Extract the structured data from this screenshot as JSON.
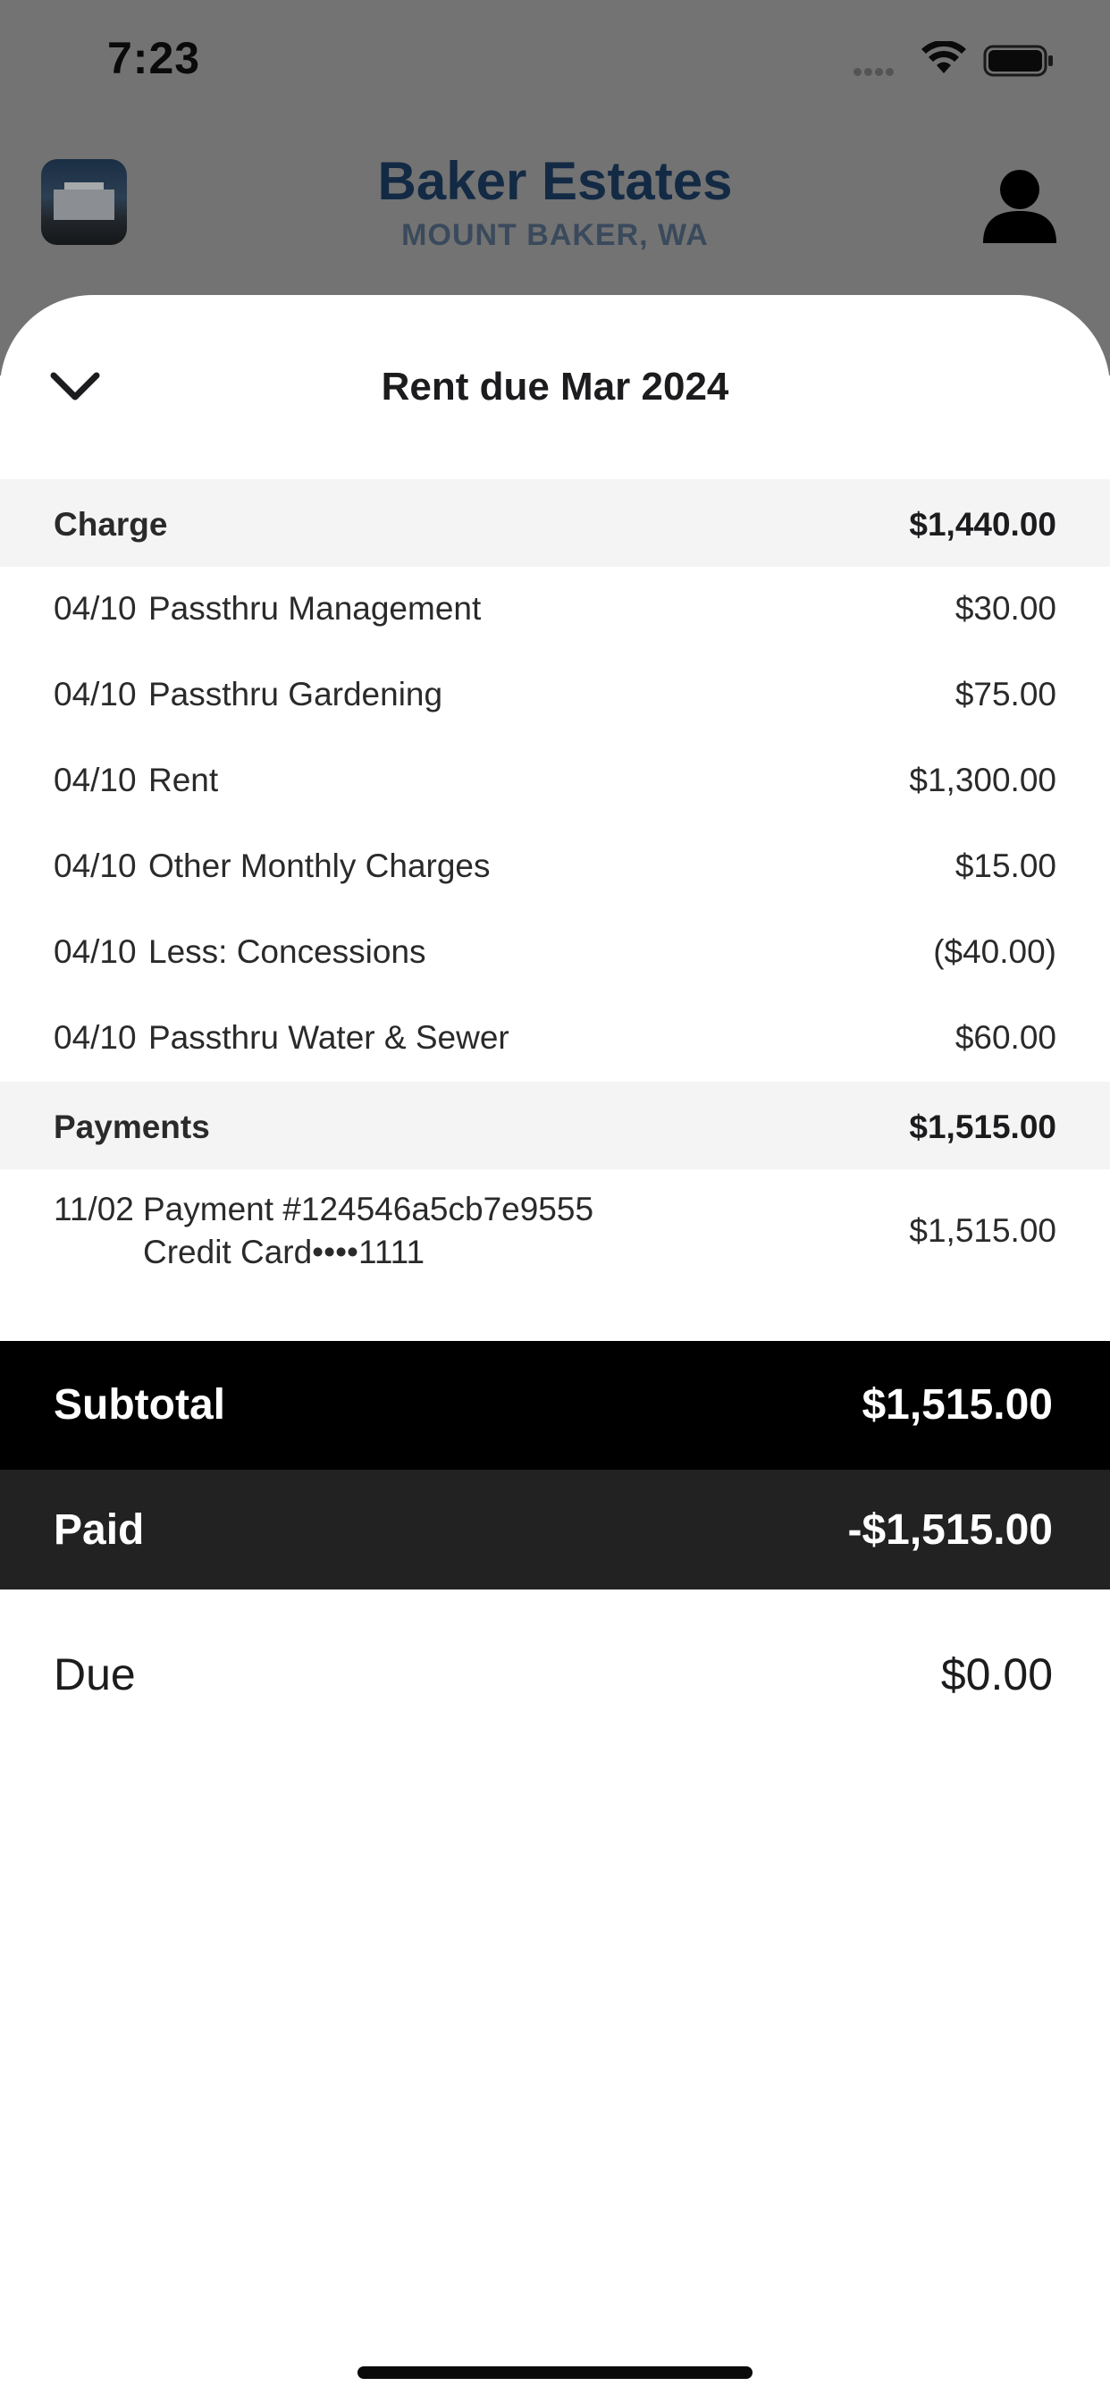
{
  "status_bar": {
    "time": "7:23"
  },
  "property": {
    "name": "Baker Estates",
    "location": "MOUNT BAKER, WA"
  },
  "sheet": {
    "title": "Rent due Mar 2024"
  },
  "charges": {
    "label": "Charge",
    "total": "$1,440.00",
    "items": [
      {
        "date": "04/10",
        "description": "Passthru Management",
        "amount": "$30.00"
      },
      {
        "date": "04/10",
        "description": "Passthru Gardening",
        "amount": "$75.00"
      },
      {
        "date": "04/10",
        "description": "Rent",
        "amount": "$1,300.00"
      },
      {
        "date": "04/10",
        "description": "Other Monthly Charges",
        "amount": "$15.00"
      },
      {
        "date": "04/10",
        "description": "Less: Concessions",
        "amount": "($40.00)"
      },
      {
        "date": "04/10",
        "description": "Passthru Water & Sewer",
        "amount": "$60.00"
      }
    ]
  },
  "payments": {
    "label": "Payments",
    "total": "$1,515.00",
    "items": [
      {
        "date": "11/02",
        "description": "Payment #124546a5cb7e9555",
        "method": "Credit Card••••1111",
        "amount": "$1,515.00"
      }
    ]
  },
  "summary": {
    "subtotal_label": "Subtotal",
    "subtotal_amount": "$1,515.00",
    "paid_label": "Paid",
    "paid_amount": "-$1,515.00",
    "due_label": "Due",
    "due_amount": "$0.00"
  },
  "colors": {
    "subtotal_bar": "#000000",
    "paid_bar": "#222222",
    "section_header_bg": "#f4f4f4",
    "brand_text": "#132a45"
  }
}
